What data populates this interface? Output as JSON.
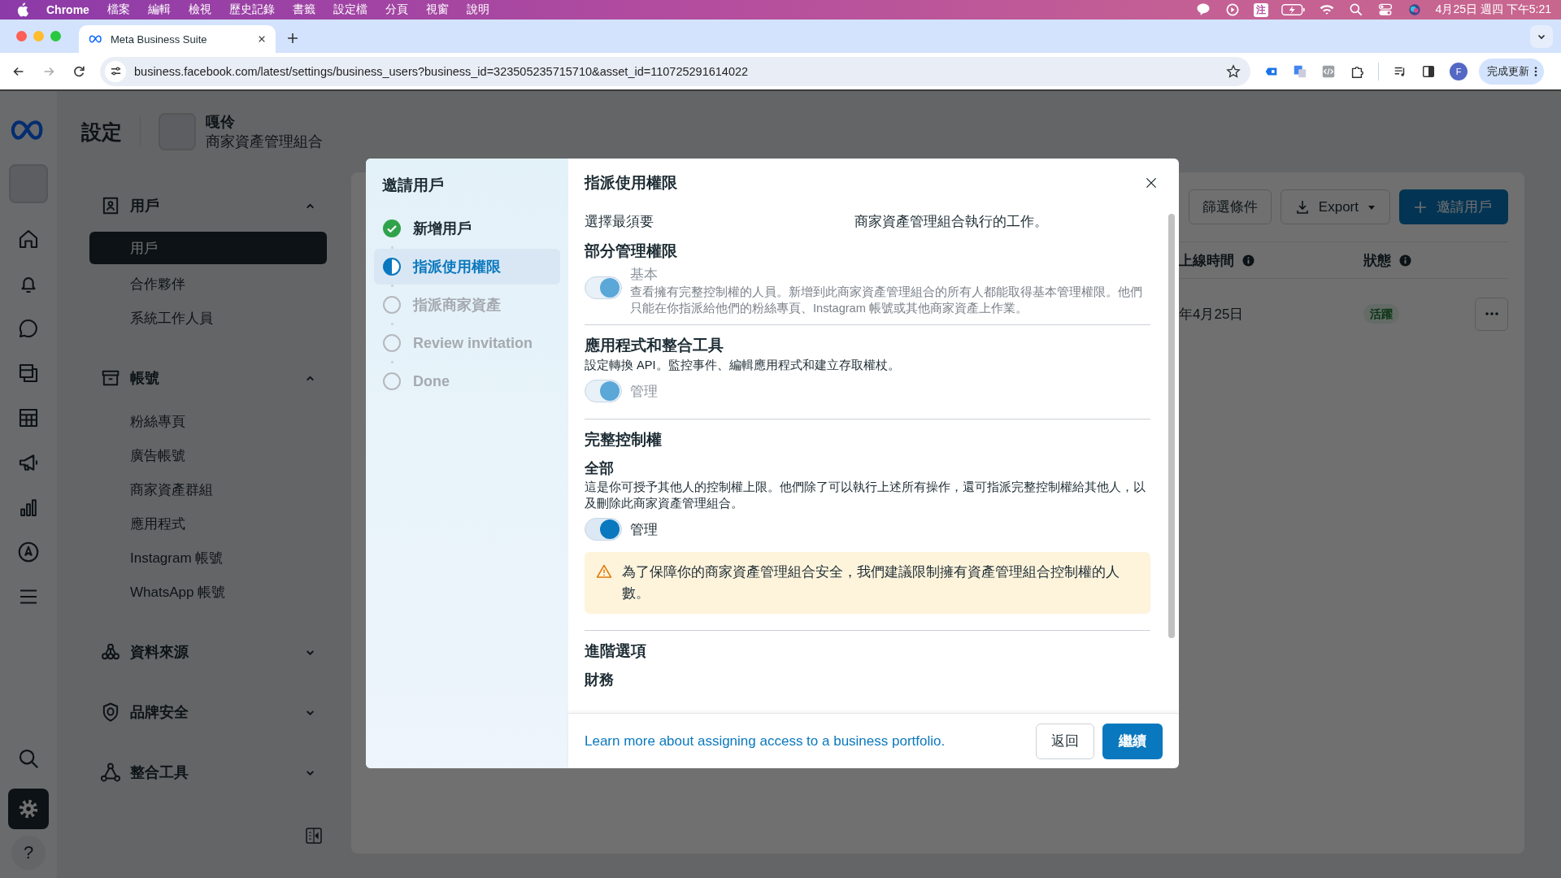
{
  "menubar": {
    "app_name": "Chrome",
    "menus": [
      "檔案",
      "編輯",
      "檢視",
      "歷史記錄",
      "書籤",
      "設定檔",
      "分頁",
      "視窗",
      "說明"
    ],
    "input_method": "注",
    "clock": "4月25日 週四 下午5:21"
  },
  "browser": {
    "tabs": [
      {
        "title": "Meta Business Suite",
        "selected": true
      }
    ],
    "url": "business.facebook.com/latest/settings/business_users?business_id=323505235715710&asset_id=110725291614022",
    "profile_initial": "F",
    "update_button": "完成更新"
  },
  "rail": {
    "top_items": [
      {
        "selected": false
      },
      {
        "selected": false
      },
      {
        "selected": false
      },
      {
        "selected": false
      },
      {
        "selected": false
      },
      {
        "selected": false
      },
      {
        "selected": false
      },
      {
        "selected": false
      },
      {
        "selected": false
      }
    ],
    "bottom_items": [
      {
        "selected": false
      },
      {
        "selected": true
      }
    ],
    "help": "?"
  },
  "header": {
    "title": "設定",
    "business_name": "嘎伶",
    "business_type": "商家資產管理組合"
  },
  "sidebar": {
    "sections": [
      {
        "label": "用戶",
        "expanded": true,
        "items": [
          {
            "label": "用戶",
            "selected": true
          },
          {
            "label": "合作夥伴",
            "selected": false
          },
          {
            "label": "系統工作人員",
            "selected": false
          }
        ]
      },
      {
        "label": "帳號",
        "expanded": true,
        "items": [
          {
            "label": "粉絲專頁",
            "selected": false
          },
          {
            "label": "廣告帳號",
            "selected": false
          },
          {
            "label": "商家資產群組",
            "selected": false
          },
          {
            "label": "應用程式",
            "selected": false
          },
          {
            "label": "Instagram 帳號",
            "selected": false
          },
          {
            "label": "WhatsApp 帳號",
            "selected": false
          }
        ]
      },
      {
        "label": "資料來源",
        "expanded": false
      },
      {
        "label": "品牌安全",
        "expanded": false
      },
      {
        "label": "整合工具",
        "expanded": false
      }
    ]
  },
  "users_panel": {
    "filter_button": "篩選條件",
    "export_button": "Export",
    "invite_button": "邀請用戶",
    "columns": [
      "上線時間",
      "狀態"
    ],
    "rows": [
      {
        "cells": [
          "年4月25日",
          "活躍"
        ]
      }
    ]
  },
  "dialog": {
    "title": "邀請用戶",
    "steps": [
      {
        "label": "新增用戶",
        "completed": true,
        "selected": false
      },
      {
        "label": "指派使用權限",
        "completed": false,
        "selected": true
      },
      {
        "label": "指派商家資產",
        "completed": false,
        "selected": false
      },
      {
        "label": "Review invitation",
        "completed": false,
        "selected": false
      },
      {
        "label": "Done",
        "completed": false,
        "selected": false
      }
    ],
    "heading": "指派使用權限",
    "intro": [
      "選擇最須要",
      "商家資產管理組合執行的工作。"
    ],
    "sections": [
      {
        "title": "部分管理權限",
        "kind": "inline",
        "toggle": {
          "label": "基本",
          "on": true,
          "disabled": true
        },
        "description": "查看擁有完整控制權的人員。新增到此商家資產管理組合的所有人都能取得基本管理權限。他們只能在你指派給他們的粉絲專頁、Instagram 帳號或其他商家資產上作業。"
      },
      {
        "title": "應用程式和整合工具",
        "kind": "stacked",
        "description": "設定轉換 API。監控事件、編輯應用程式和建立存取權杖。",
        "toggle": {
          "label": "管理",
          "on": true,
          "disabled": true
        }
      },
      {
        "title": "完整控制權",
        "subtitle": "全部",
        "kind": "stacked",
        "description": "這是你可授予其他人的控制權上限。他們除了可以執行上述所有操作，還可指派完整控制權給其他人，以及刪除此商家資產管理組合。",
        "toggle": {
          "label": "管理",
          "on": true,
          "disabled": false
        },
        "warning": "為了保障你的商家資產管理組合安全，我們建議限制擁有資產管理組合控制權的人數。"
      },
      {
        "title": "進階選項",
        "subtitle": "財務",
        "kind": "stacked"
      }
    ],
    "link": "Learn more about assigning access to a business portfolio.",
    "back_button": "返回",
    "continue_button": "繼續"
  }
}
